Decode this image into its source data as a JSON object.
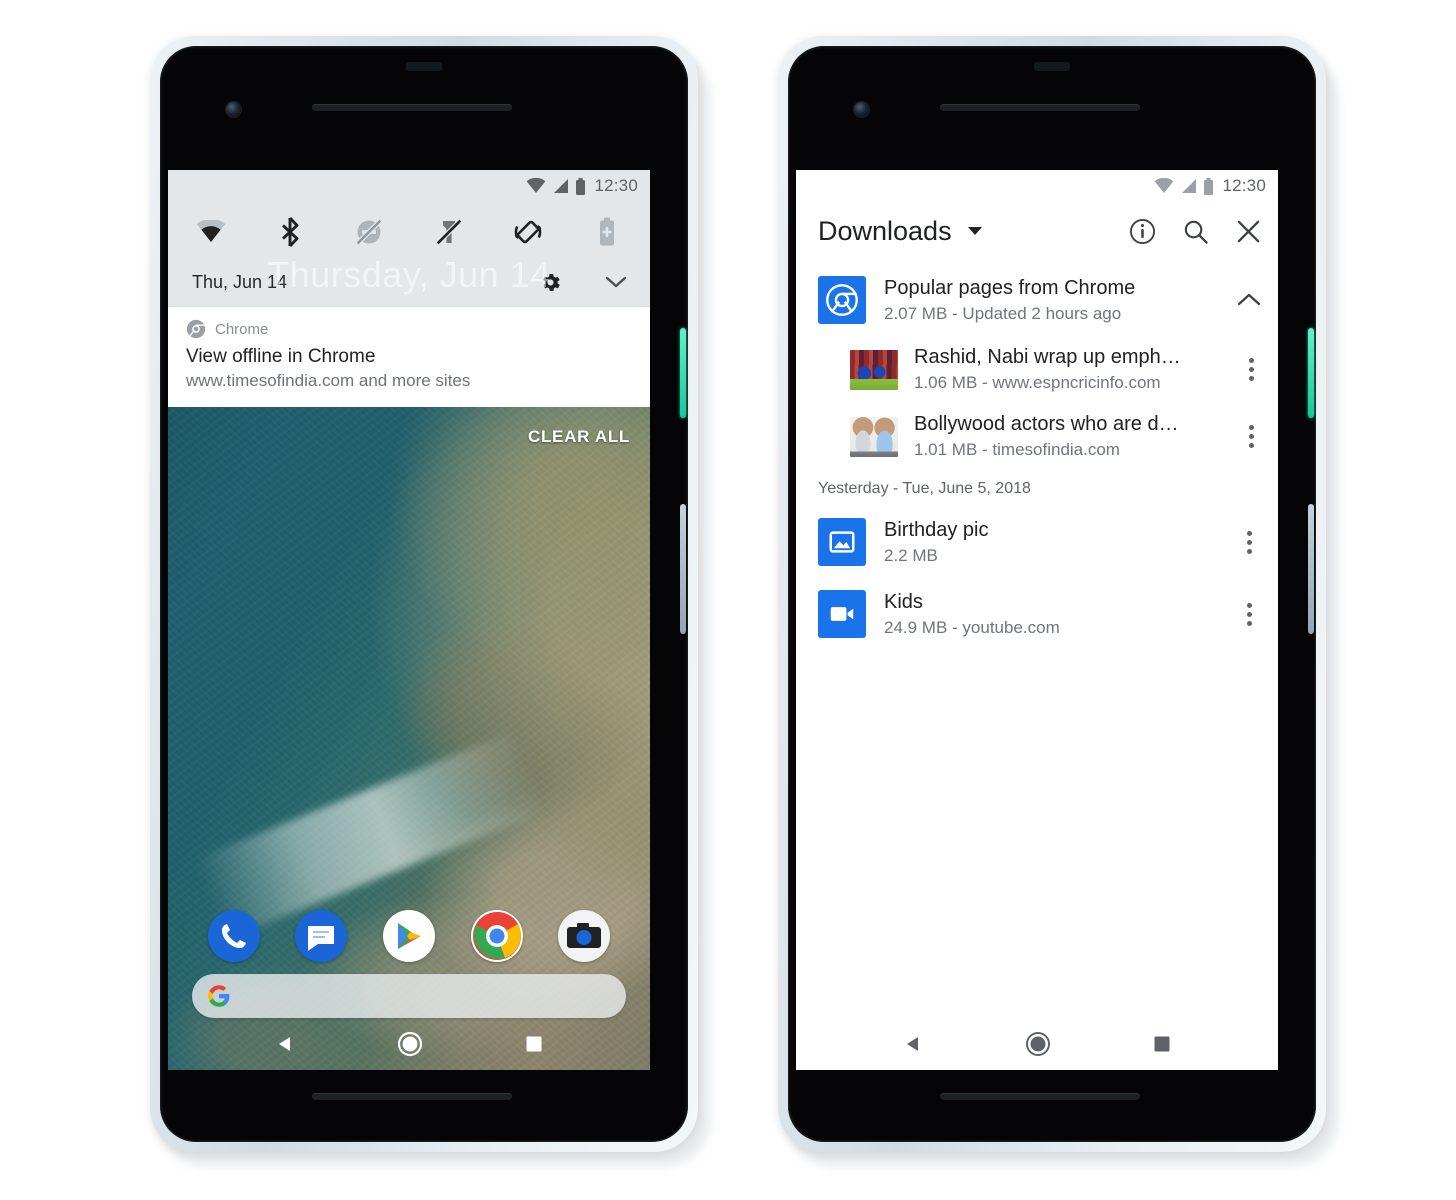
{
  "left_phone": {
    "status_bar": {
      "time": "12:30",
      "icons": [
        "wifi-icon",
        "cell-signal-icon",
        "battery-icon"
      ]
    },
    "quick_settings": {
      "tiles": [
        {
          "name": "wifi-tile",
          "label": "Wi-Fi",
          "state": "on"
        },
        {
          "name": "bluetooth-tile",
          "label": "Bluetooth",
          "state": "on"
        },
        {
          "name": "do-not-disturb-tile",
          "label": "Do Not Disturb",
          "state": "off"
        },
        {
          "name": "flashlight-tile",
          "label": "Flashlight",
          "state": "off"
        },
        {
          "name": "auto-rotate-tile",
          "label": "Auto-rotate",
          "state": "on"
        },
        {
          "name": "battery-saver-tile",
          "label": "Battery Saver",
          "state": "off"
        }
      ],
      "date": "Thu, Jun 14",
      "ghost_date": "Thursday, Jun 14",
      "settings_icon": "gear-icon",
      "expand_icon": "chevron-down-icon"
    },
    "notification": {
      "app_icon": "chrome-icon",
      "app_name": "Chrome",
      "title": "View offline in Chrome",
      "subtitle": "www.timesofindia.com and more sites"
    },
    "clear_all_label": "CLEAR ALL",
    "dock": [
      {
        "name": "phone-app-icon",
        "label": "Phone"
      },
      {
        "name": "messages-app-icon",
        "label": "Messages"
      },
      {
        "name": "play-store-app-icon",
        "label": "Play Store"
      },
      {
        "name": "chrome-app-icon",
        "label": "Chrome"
      },
      {
        "name": "camera-app-icon",
        "label": "Camera"
      }
    ],
    "search_bar": {
      "logo": "google-g-icon",
      "value": "",
      "placeholder": ""
    },
    "nav_bar": [
      "back-icon",
      "home-icon",
      "recents-icon"
    ]
  },
  "right_phone": {
    "status_bar": {
      "time": "12:30",
      "icons": [
        "wifi-icon",
        "cell-signal-icon",
        "battery-icon"
      ]
    },
    "app_bar": {
      "title": "Downloads",
      "dropdown_icon": "chevron-down-icon",
      "actions": [
        "info-icon",
        "search-icon",
        "close-icon"
      ]
    },
    "group": {
      "icon": "chrome-icon",
      "title": "Popular pages from Chrome",
      "meta": "2.07 MB - Updated 2 hours ago",
      "collapse_icon": "chevron-up-icon",
      "items": [
        {
          "thumb": "cricket-thumbnail",
          "title": "Rashid, Nabi wrap up emph…",
          "meta": "1.06 MB - www.espncricinfo.com",
          "menu_icon": "kebab-menu-icon"
        },
        {
          "thumb": "people-thumbnail",
          "title": "Bollywood actors who are d…",
          "meta": "1.01 MB - timesofindia.com",
          "menu_icon": "kebab-menu-icon"
        }
      ]
    },
    "date_header": "Yesterday - Tue, June 5, 2018",
    "files": [
      {
        "icon": "image-file-icon",
        "title": "Birthday pic",
        "meta": "2.2 MB",
        "menu_icon": "kebab-menu-icon"
      },
      {
        "icon": "video-file-icon",
        "title": "Kids",
        "meta": "24.9 MB - youtube.com",
        "menu_icon": "kebab-menu-icon"
      }
    ],
    "nav_bar": [
      "back-icon",
      "home-icon",
      "recents-icon"
    ]
  },
  "colors": {
    "accent_blue": "#1a73e8",
    "power_button_teal": "#3ce0b0",
    "shade_grey": "#e3e7ea",
    "text_primary": "#202124",
    "text_secondary": "#70757a"
  }
}
